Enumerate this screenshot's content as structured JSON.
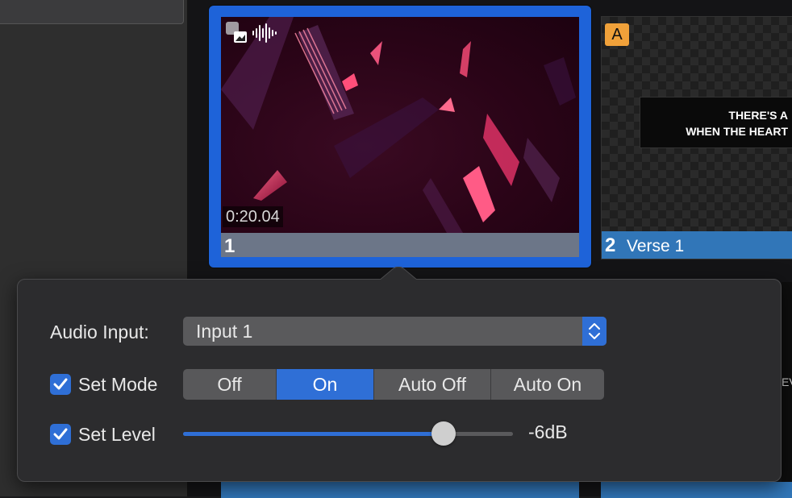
{
  "slides": [
    {
      "number": "1",
      "timecode": "0:20.04",
      "selected": true
    },
    {
      "number": "2",
      "name": "Verse 1",
      "badge": "A",
      "lyrics": [
        "THERE'S A",
        "WHEN THE HEART"
      ]
    }
  ],
  "peek_text": "EV",
  "popover": {
    "audio_input_label": "Audio Input:",
    "audio_input_value": "Input 1",
    "set_mode_label": "Set Mode",
    "set_mode_checked": true,
    "modes": [
      "Off",
      "On",
      "Auto Off",
      "Auto On"
    ],
    "mode_selected": "On",
    "set_level_label": "Set Level",
    "set_level_checked": true,
    "level_fraction": 0.79,
    "level_value": "-6dB"
  },
  "colors": {
    "accent": "#2f6fd6",
    "badge": "#f0a13a",
    "slide_label": "#3176b8"
  }
}
